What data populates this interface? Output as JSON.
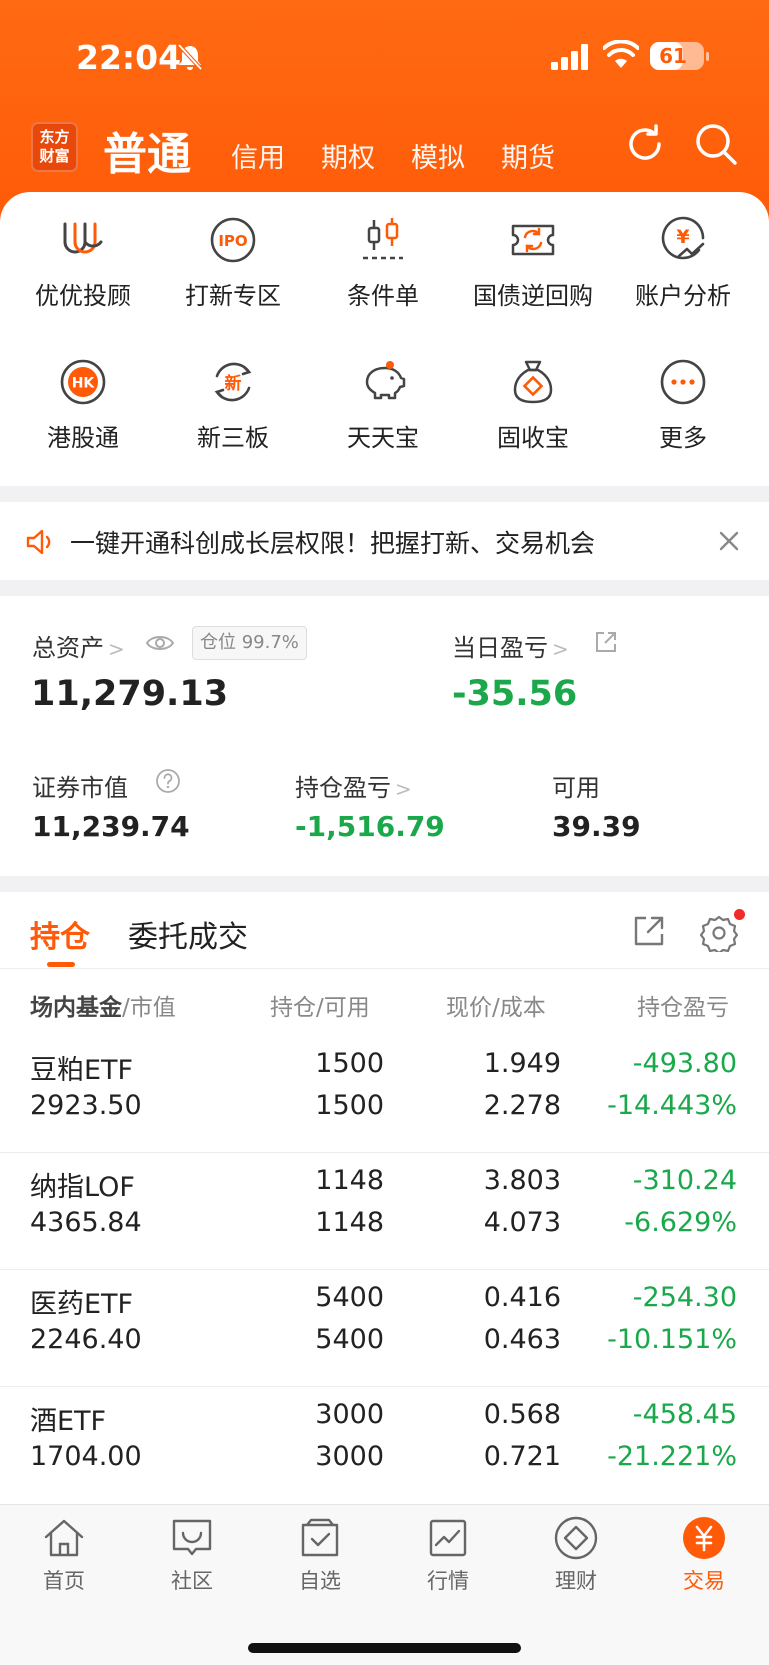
{
  "status": {
    "time": "22:04",
    "battery": "61",
    "battery_level": 0.61
  },
  "nav": {
    "logo_line1": "东方",
    "logo_line2": "财富",
    "tabs": [
      "普通",
      "信用",
      "期权",
      "模拟",
      "期货"
    ]
  },
  "grid": [
    {
      "label": "优优投顾",
      "icon": "uu-advisor-icon"
    },
    {
      "label": "打新专区",
      "icon": "ipo-icon",
      "text": "IPO"
    },
    {
      "label": "条件单",
      "icon": "candlestick-icon"
    },
    {
      "label": "国债逆回购",
      "icon": "repo-ticket-icon"
    },
    {
      "label": "账户分析",
      "icon": "yuan-chart-icon",
      "text": "¥"
    },
    {
      "label": "港股通",
      "icon": "hk-icon",
      "text": "HK"
    },
    {
      "label": "新三板",
      "icon": "new-board-icon",
      "text": "新"
    },
    {
      "label": "天天宝",
      "icon": "piggy-bank-icon"
    },
    {
      "label": "固收宝",
      "icon": "money-bag-icon"
    },
    {
      "label": "更多",
      "icon": "more-icon"
    }
  ],
  "notice": {
    "text": "一键开通科创成长层权限！把握打新、交易机会"
  },
  "assets": {
    "total_label": "总资产",
    "position_badge": "仓位 99.7%",
    "total_value": "11,279.13",
    "daily_pnl_label": "当日盈亏",
    "daily_pnl_value": "-35.56",
    "market_value_label": "证券市值",
    "market_value": "11,239.74",
    "holding_pnl_label": "持仓盈亏",
    "holding_pnl_value": "-1,516.79",
    "available_label": "可用",
    "available_value": "39.39"
  },
  "holdings": {
    "tabs": [
      "持仓",
      "委托成交"
    ],
    "headers": {
      "col1_main": "场内基金",
      "col1_sub": "市值",
      "col2": "持仓/可用",
      "col3": "现价/成本",
      "col4": "持仓盈亏"
    },
    "rows": [
      {
        "name": "豆粕ETF",
        "mv": "2923.50",
        "hold": "1500",
        "avail": "1500",
        "price": "1.949",
        "cost": "2.278",
        "pnl": "-493.80",
        "pnl_pct": "-14.443%"
      },
      {
        "name": "纳指LOF",
        "mv": "4365.84",
        "hold": "1148",
        "avail": "1148",
        "price": "3.803",
        "cost": "4.073",
        "pnl": "-310.24",
        "pnl_pct": "-6.629%"
      },
      {
        "name": "医药ETF",
        "mv": "2246.40",
        "hold": "5400",
        "avail": "5400",
        "price": "0.416",
        "cost": "0.463",
        "pnl": "-254.30",
        "pnl_pct": "-10.151%"
      },
      {
        "name": "酒ETF",
        "mv": "1704.00",
        "hold": "3000",
        "avail": "3000",
        "price": "0.568",
        "cost": "0.721",
        "pnl": "-458.45",
        "pnl_pct": "-21.221%"
      }
    ]
  },
  "tabbar": [
    {
      "label": "首页",
      "icon": "home-icon"
    },
    {
      "label": "社区",
      "icon": "community-icon"
    },
    {
      "label": "自选",
      "icon": "watchlist-icon"
    },
    {
      "label": "行情",
      "icon": "market-icon"
    },
    {
      "label": "理财",
      "icon": "wealth-icon"
    },
    {
      "label": "交易",
      "icon": "trade-icon",
      "active": true
    }
  ],
  "colors": {
    "brand": "#ff5a08",
    "loss": "#1aa84a"
  }
}
